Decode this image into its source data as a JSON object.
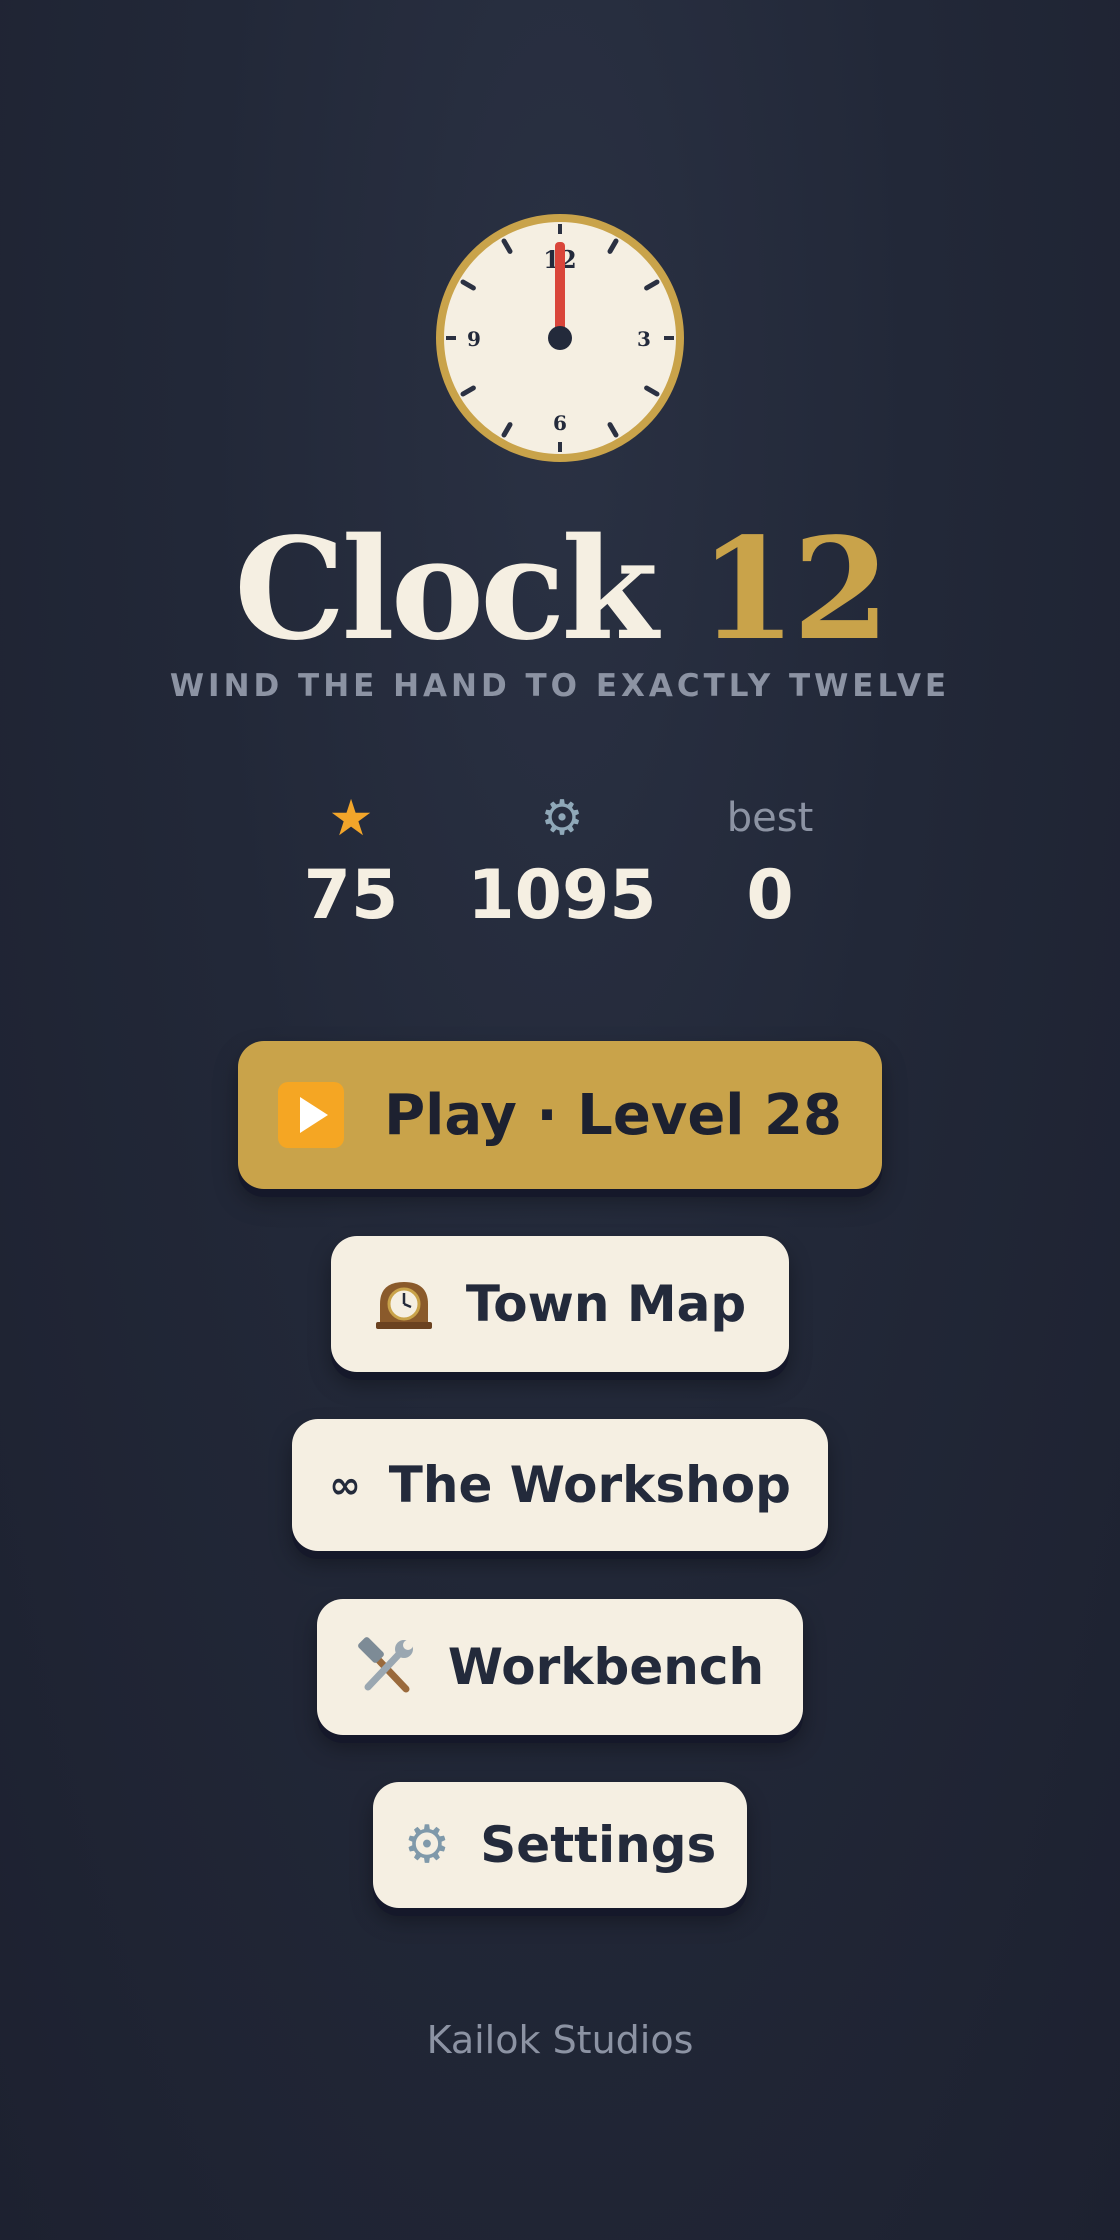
{
  "clock": {
    "numerals": [
      "12",
      "3",
      "6",
      "9"
    ],
    "hand_hour": 12,
    "colors": {
      "face": "#f5efe2",
      "rim": "#c9a34a",
      "hand": "#d9453a",
      "ticks": "#2b3142",
      "hub": "#232a3b"
    }
  },
  "title": {
    "word": "Clock",
    "number": "12",
    "subtitle": "WIND THE HAND TO EXACTLY TWELVE"
  },
  "stats": [
    {
      "icon": "star-icon",
      "glyph": "★",
      "value": "75"
    },
    {
      "icon": "gear-icon",
      "glyph": "⚙",
      "value": "1095"
    },
    {
      "label": "best",
      "value": "0"
    }
  ],
  "menu": {
    "play": {
      "icon": "play-icon",
      "label": "Play · Level 28"
    },
    "town_map": {
      "icon": "mantel-clock-icon",
      "label": "Town Map"
    },
    "workshop": {
      "icon": "infinity-icon",
      "glyph": "∞",
      "label": "The Workshop"
    },
    "workbench": {
      "icon": "hammer-wrench-icon",
      "label": "Workbench"
    },
    "settings": {
      "icon": "gear-icon",
      "glyph": "⚙",
      "label": "Settings"
    }
  },
  "footer": "Kailok Studios",
  "colors": {
    "background": "#1d2130",
    "accent_gold": "#c9a34a",
    "cream": "#f5efe2",
    "muted": "#8c93a3",
    "star": "#f2a52a"
  }
}
